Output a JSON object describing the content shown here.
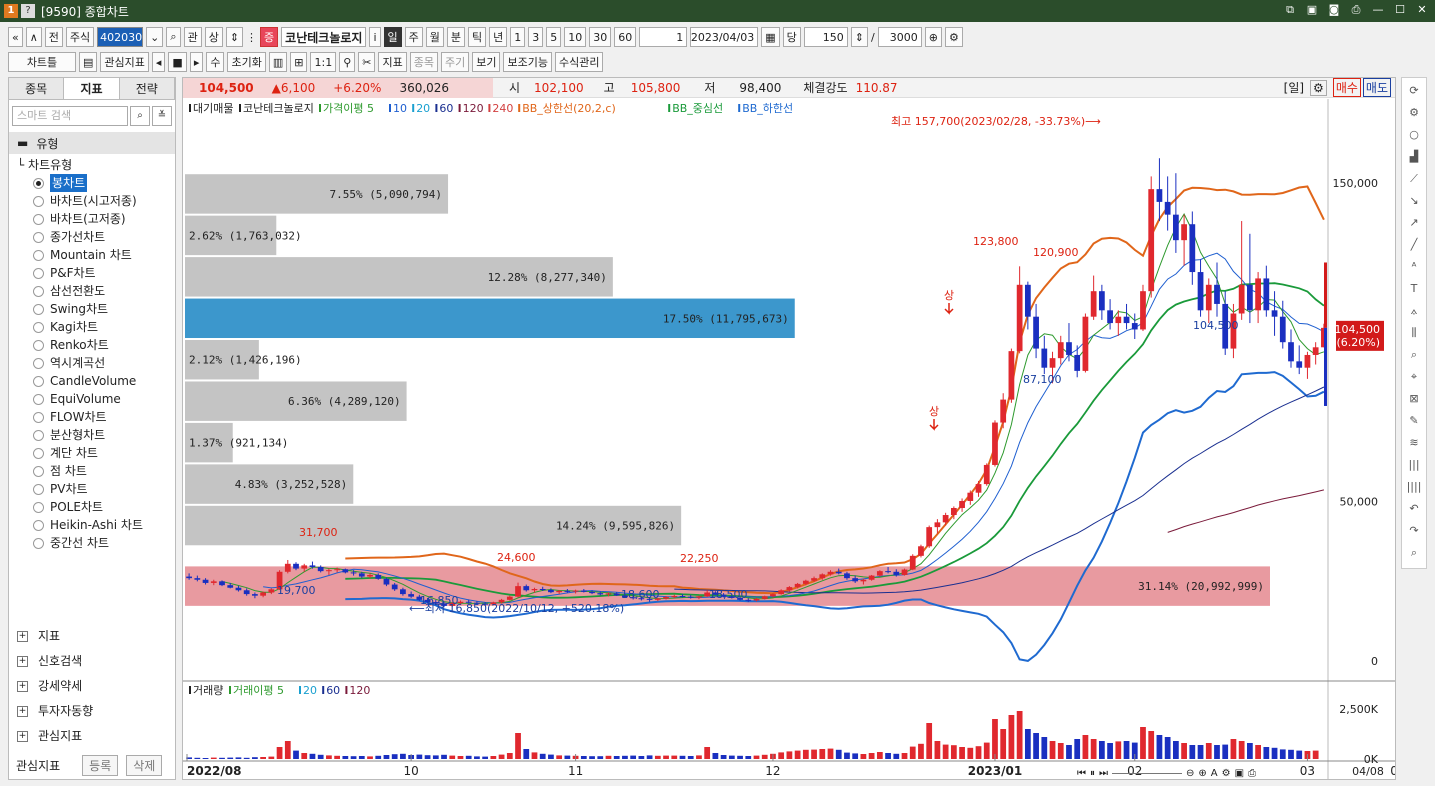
{
  "window": {
    "title": "[9590] 종합차트",
    "logo": "1",
    "logo2": "?"
  },
  "toolbar1": {
    "nav_first": "«",
    "nav_up": "∧",
    "prev": "전",
    "market": "주식",
    "code": "402030",
    "search_icon": "⌕",
    "gwan": "관",
    "sang": "상",
    "badge": "증",
    "stock_name": "코난테크놀로지",
    "info_icon": "i",
    "periods": [
      "일",
      "주",
      "월",
      "분",
      "틱",
      "년"
    ],
    "period_selected": "일",
    "intervals": [
      "1",
      "3",
      "5",
      "10",
      "30",
      "60"
    ],
    "count_select": "1",
    "date": "2023/04/03",
    "dang": "당",
    "bars": "150",
    "slash": "/",
    "total": "3000"
  },
  "toolbar2": {
    "chart_tools": "차트틀",
    "fav_indicator": "관심지표",
    "su": "수",
    "reset": "초기화",
    "ratio": "1:1",
    "indicator": "지표",
    "item": "종목",
    "period": "주기",
    "view": "보기",
    "aux": "보조기능",
    "formula": "수식관리"
  },
  "leftpanel": {
    "tabs": [
      "종목",
      "지표",
      "전략"
    ],
    "active_tab": "지표",
    "search_placeholder": "스마트 검색",
    "section": "유형",
    "tree_root": "차트유형",
    "items": [
      "봉차트",
      "바차트(시고저종)",
      "바차트(고저종)",
      "종가선차트",
      "Mountain 차트",
      "P&F차트",
      "삼선전환도",
      "Swing차트",
      "Kagi차트",
      "Renko차트",
      "역시계곡선",
      "CandleVolume",
      "EquiVolume",
      "FLOW차트",
      "분산형차트",
      "계단 차트",
      "점 차트",
      "PV차트",
      "POLE차트",
      "Heikin-Ashi 차트",
      "중간선 차트"
    ],
    "selected_item": "봉차트",
    "groups": [
      "지표",
      "신호검색",
      "강세약세",
      "투자자동향",
      "관심지표"
    ],
    "fav_label": "관심지표",
    "btn_register": "등록",
    "btn_delete": "삭제"
  },
  "infobar": {
    "price": "104,500",
    "change": "▲6,100",
    "pct": "+6.20%",
    "volume": "360,026",
    "open_label": "시",
    "open": "102,100",
    "high_label": "고",
    "high": "105,800",
    "low_label": "저",
    "low": "98,400",
    "strength_label": "체결강도",
    "strength": "110.87",
    "period_tag": "[일]",
    "buy": "매수",
    "sell": "매도"
  },
  "legend": {
    "items": [
      {
        "text": "대기매물",
        "color": "#222222"
      },
      {
        "text": "코난테크놀로지",
        "color": "#222222"
      },
      {
        "text": "가격이평 5",
        "color": "#2e9a2e"
      },
      {
        "text": "10",
        "color": "#1f5fd0"
      },
      {
        "text": "20",
        "color": "#1aa0d0"
      },
      {
        "text": "60",
        "color": "#1a2f90"
      },
      {
        "text": "120",
        "color": "#7a1a3a"
      },
      {
        "text": "240",
        "color": "#d24040"
      },
      {
        "text": "BB_상한선(20,2,c)",
        "color": "#e0661a"
      },
      {
        "text": "BB_중심선",
        "color": "#1a9a3a"
      },
      {
        "text": "BB_하한선",
        "color": "#1f6ad0"
      }
    ]
  },
  "volume_legend": {
    "items": [
      {
        "text": "거래량",
        "color": "#222222"
      },
      {
        "text": "거래이평 5",
        "color": "#2e9a2e"
      },
      {
        "text": "20",
        "color": "#1aa0d0"
      },
      {
        "text": "60",
        "color": "#1a2f90"
      },
      {
        "text": "120",
        "color": "#7a1a3a"
      }
    ]
  },
  "chart_data": {
    "type": "candlestick",
    "y_axis": {
      "ticks": [
        "150,000",
        "50,000",
        "0"
      ],
      "ylim": [
        -5000,
        170000
      ]
    },
    "x_axis": {
      "ticks": [
        "2022/08",
        "10",
        "11",
        "12",
        "2023/01",
        "02",
        "03",
        "04"
      ],
      "last_date": "04/08"
    },
    "volume_axis": {
      "ticks": [
        "2,500K",
        "0K"
      ]
    },
    "current_price_tag": {
      "price": "104,500",
      "pct": "(6.20%)"
    },
    "volume_profile": [
      {
        "label": "7.55% (5,090,794)",
        "pct": 7.55,
        "price_low": 140000,
        "price_high": 153000
      },
      {
        "label": "2.62% (1,763,032)",
        "pct": 2.62,
        "price_low": 127000,
        "price_high": 140000
      },
      {
        "label": "12.28% (8,277,340)",
        "pct": 12.28,
        "price_low": 114000,
        "price_high": 127000
      },
      {
        "label": "17.50% (11,795,673)",
        "pct": 17.5,
        "price_low": 101000,
        "price_high": 114000,
        "highlight": "current"
      },
      {
        "label": "2.12% (1,426,196)",
        "pct": 2.12,
        "price_low": 88000,
        "price_high": 101000
      },
      {
        "label": "6.36% (4,289,120)",
        "pct": 6.36,
        "price_low": 75000,
        "price_high": 88000
      },
      {
        "label": "1.37% (921,134)",
        "pct": 1.37,
        "price_low": 62000,
        "price_high": 75000
      },
      {
        "label": "4.83% (3,252,528)",
        "pct": 4.83,
        "price_low": 49000,
        "price_high": 62000
      },
      {
        "label": "14.24% (9,595,826)",
        "pct": 14.24,
        "price_low": 36000,
        "price_high": 49000
      },
      {
        "label": "31.14% (20,992,999)",
        "pct": 31.14,
        "price_low": 17000,
        "price_high": 30000,
        "highlight": "max"
      }
    ],
    "annotations": [
      {
        "text": "최고 157,700(2023/02/28, -33.73%)⟶",
        "color": "#d21"
      },
      {
        "text": "⟵최저 16,850(2022/10/12, +520.18%)",
        "color": "#1a3fa0"
      },
      {
        "text": "31,700",
        "color": "#d21"
      },
      {
        "text": "19,700",
        "color": "#1a3fa0"
      },
      {
        "text": "16,850",
        "color": "#1a3fa0"
      },
      {
        "text": "24,600",
        "color": "#d21"
      },
      {
        "text": "22,250",
        "color": "#d21"
      },
      {
        "text": "18,600",
        "color": "#1a3fa0"
      },
      {
        "text": "18,500",
        "color": "#1a3fa0"
      },
      {
        "text": "123,800",
        "color": "#d21"
      },
      {
        "text": "120,900",
        "color": "#d21"
      },
      {
        "text": "87,100",
        "color": "#1a3fa0"
      },
      {
        "text": "104,500",
        "color": "#1a3fa0"
      },
      {
        "text": "상",
        "color": "#d21"
      },
      {
        "text": "상",
        "color": "#d21"
      }
    ],
    "ohlc": [
      [
        26500,
        27500,
        25500,
        26000
      ],
      [
        26000,
        26800,
        25000,
        25500
      ],
      [
        25500,
        26000,
        24000,
        24500
      ],
      [
        24500,
        25500,
        23800,
        25000
      ],
      [
        25000,
        25300,
        23500,
        23800
      ],
      [
        23800,
        24500,
        22800,
        23000
      ],
      [
        23000,
        23600,
        21800,
        22200
      ],
      [
        22200,
        22800,
        20500,
        21000
      ],
      [
        21000,
        21500,
        19700,
        20500
      ],
      [
        20500,
        21800,
        20000,
        21500
      ],
      [
        21500,
        22800,
        21000,
        22500
      ],
      [
        22500,
        28500,
        22300,
        28000
      ],
      [
        28000,
        31700,
        27500,
        30500
      ],
      [
        30500,
        31000,
        28500,
        29000
      ],
      [
        29000,
        30500,
        28000,
        30000
      ],
      [
        30000,
        31200,
        29000,
        29500
      ],
      [
        29500,
        30000,
        27800,
        28200
      ],
      [
        28200,
        29000,
        27000,
        28500
      ],
      [
        28500,
        29300,
        27800,
        28800
      ],
      [
        28800,
        29000,
        27500,
        27800
      ],
      [
        27800,
        28500,
        26800,
        27500
      ],
      [
        27500,
        28000,
        26000,
        26500
      ],
      [
        26500,
        27500,
        26000,
        27000
      ],
      [
        27000,
        27500,
        25500,
        25800
      ],
      [
        25800,
        26200,
        23500,
        24000
      ],
      [
        24000,
        24500,
        22000,
        22500
      ],
      [
        22500,
        23000,
        20500,
        21000
      ],
      [
        21000,
        21800,
        19800,
        20200
      ],
      [
        20200,
        20800,
        18800,
        19200
      ],
      [
        19200,
        19800,
        18000,
        18500
      ],
      [
        18500,
        19200,
        17500,
        18000
      ],
      [
        18000,
        18600,
        16850,
        17300
      ],
      [
        17300,
        18500,
        17000,
        18200
      ],
      [
        18200,
        19000,
        17800,
        18600
      ],
      [
        18600,
        19300,
        18000,
        18300
      ],
      [
        18300,
        18800,
        17600,
        18000
      ],
      [
        18000,
        18500,
        17300,
        17800
      ],
      [
        17800,
        18600,
        17500,
        18400
      ],
      [
        18400,
        19500,
        18000,
        19200
      ],
      [
        19200,
        20500,
        19000,
        20200
      ],
      [
        20200,
        24600,
        20000,
        23500
      ],
      [
        23500,
        24000,
        21800,
        22200
      ],
      [
        22200,
        23000,
        21500,
        22600
      ],
      [
        22600,
        23300,
        22000,
        22300
      ],
      [
        22300,
        22800,
        21300,
        21600
      ],
      [
        21600,
        22300,
        21000,
        22000
      ],
      [
        22000,
        22600,
        21400,
        21800
      ],
      [
        21800,
        22400,
        21200,
        22100
      ],
      [
        22100,
        22600,
        21500,
        21700
      ],
      [
        21700,
        22200,
        21000,
        21300
      ],
      [
        21300,
        21800,
        20600,
        20900
      ],
      [
        20900,
        21500,
        20300,
        21200
      ],
      [
        21200,
        21600,
        20400,
        20600
      ],
      [
        20600,
        21100,
        19800,
        20000
      ],
      [
        20000,
        20600,
        19300,
        19700
      ],
      [
        19700,
        20300,
        19000,
        19500
      ],
      [
        19500,
        20100,
        18600,
        19200
      ],
      [
        19200,
        19800,
        18800,
        19600
      ],
      [
        19600,
        20400,
        19300,
        20100
      ],
      [
        20100,
        20800,
        19700,
        20400
      ],
      [
        20400,
        21000,
        19900,
        20200
      ],
      [
        20200,
        20700,
        19600,
        19900
      ],
      [
        19900,
        20500,
        19400,
        20300
      ],
      [
        20300,
        22250,
        20100,
        21500
      ],
      [
        21500,
        21900,
        20600,
        20800
      ],
      [
        20800,
        21300,
        20000,
        20300
      ],
      [
        20300,
        20800,
        19600,
        19800
      ],
      [
        19800,
        20300,
        18900,
        19200
      ],
      [
        19200,
        19700,
        18500,
        19000
      ],
      [
        19000,
        19800,
        18700,
        19500
      ],
      [
        19500,
        20500,
        19300,
        20300
      ],
      [
        20300,
        21300,
        20000,
        21000
      ],
      [
        21000,
        22500,
        20800,
        22200
      ],
      [
        22200,
        23500,
        21800,
        23200
      ],
      [
        23200,
        24500,
        22800,
        24200
      ],
      [
        24200,
        25500,
        23800,
        25200
      ],
      [
        25200,
        26500,
        24800,
        26000
      ],
      [
        26000,
        27500,
        25500,
        27200
      ],
      [
        27200,
        28500,
        26800,
        28000
      ],
      [
        28000,
        29000,
        27200,
        27500
      ],
      [
        27500,
        28000,
        25500,
        26000
      ],
      [
        26000,
        26800,
        24500,
        25000
      ],
      [
        25000,
        25800,
        24000,
        25500
      ],
      [
        25500,
        27000,
        25200,
        26800
      ],
      [
        26800,
        28500,
        26500,
        28200
      ],
      [
        28200,
        29500,
        27500,
        28000
      ],
      [
        28000,
        28800,
        26500,
        27000
      ],
      [
        27000,
        29000,
        26800,
        28700
      ],
      [
        28700,
        33500,
        28500,
        33000
      ],
      [
        33000,
        36500,
        32500,
        36000
      ],
      [
        36000,
        42500,
        35500,
        42000
      ],
      [
        42000,
        44500,
        40000,
        43500
      ],
      [
        43500,
        46500,
        42500,
        45800
      ],
      [
        45800,
        48500,
        44500,
        48000
      ],
      [
        48000,
        51000,
        46800,
        50200
      ],
      [
        50200,
        53500,
        49000,
        52800
      ],
      [
        52800,
        56500,
        51500,
        55500
      ],
      [
        55500,
        62000,
        55000,
        61500
      ],
      [
        61500,
        75500,
        61000,
        74800
      ],
      [
        74800,
        84000,
        73000,
        82000
      ],
      [
        82000,
        98000,
        81000,
        97200
      ],
      [
        97200,
        123800,
        96500,
        118000
      ],
      [
        118000,
        119000,
        104000,
        108000
      ],
      [
        108000,
        112000,
        95000,
        98000
      ],
      [
        98000,
        102000,
        90000,
        92000
      ],
      [
        92000,
        97000,
        87100,
        95000
      ],
      [
        95000,
        102000,
        93000,
        100000
      ],
      [
        100000,
        106000,
        94000,
        96000
      ],
      [
        96000,
        99000,
        89000,
        91000
      ],
      [
        91000,
        109000,
        90500,
        108000
      ],
      [
        108000,
        120900,
        107000,
        116000
      ],
      [
        116000,
        118000,
        107000,
        110000
      ],
      [
        110000,
        113500,
        104000,
        106000
      ],
      [
        106000,
        110000,
        102000,
        108000
      ],
      [
        108000,
        112000,
        104000,
        106000
      ],
      [
        106000,
        109000,
        101000,
        104000
      ],
      [
        104000,
        118000,
        103500,
        116000
      ],
      [
        116000,
        152000,
        114000,
        148000
      ],
      [
        148000,
        157700,
        138000,
        144000
      ],
      [
        144000,
        152000,
        135000,
        140000
      ],
      [
        140000,
        153000,
        128000,
        132000
      ],
      [
        132000,
        140000,
        124000,
        137000
      ],
      [
        137000,
        141000,
        118000,
        122000
      ],
      [
        122000,
        126000,
        108000,
        110000
      ],
      [
        110000,
        120000,
        106000,
        118000
      ],
      [
        118000,
        125000,
        108000,
        112000
      ],
      [
        112000,
        116000,
        96000,
        98000
      ],
      [
        98000,
        112000,
        95000,
        109000
      ],
      [
        109000,
        138000,
        107000,
        118000
      ],
      [
        118000,
        134000,
        106000,
        110000
      ],
      [
        110000,
        122000,
        106000,
        120000
      ],
      [
        120000,
        124000,
        108000,
        110000
      ],
      [
        110000,
        116000,
        102000,
        108000
      ],
      [
        108000,
        113000,
        98000,
        100000
      ],
      [
        100000,
        104000,
        92000,
        94000
      ],
      [
        94000,
        99000,
        90000,
        92000
      ],
      [
        92000,
        97000,
        88500,
        96000
      ],
      [
        96000,
        100000,
        93000,
        98400
      ],
      [
        98400,
        105800,
        98400,
        104500
      ]
    ],
    "volume": [
      80,
      60,
      50,
      70,
      60,
      70,
      80,
      60,
      90,
      100,
      120,
      600,
      900,
      420,
      300,
      260,
      210,
      180,
      160,
      150,
      140,
      150,
      130,
      160,
      200,
      240,
      260,
      200,
      220,
      190,
      180,
      210,
      170,
      150,
      160,
      130,
      120,
      150,
      220,
      300,
      1300,
      500,
      330,
      260,
      220,
      180,
      170,
      160,
      150,
      140,
      140,
      160,
      150,
      160,
      170,
      150,
      180,
      160,
      170,
      170,
      160,
      150,
      180,
      600,
      300,
      200,
      170,
      160,
      150,
      170,
      210,
      260,
      330,
      380,
      420,
      460,
      470,
      500,
      520,
      460,
      320,
      280,
      250,
      300,
      350,
      300,
      260,
      300,
      620,
      760,
      1800,
      900,
      720,
      690,
      600,
      560,
      640,
      820,
      2000,
      1500,
      2200,
      2400,
      1500,
      1300,
      1100,
      900,
      800,
      700,
      1000,
      1200,
      1000,
      900,
      800,
      880,
      900,
      820,
      1600,
      1400,
      1200,
      1100,
      900,
      800,
      700,
      700,
      800,
      700,
      720,
      1000,
      900,
      800,
      700,
      600,
      560,
      480,
      460,
      420,
      400,
      420
    ]
  }
}
